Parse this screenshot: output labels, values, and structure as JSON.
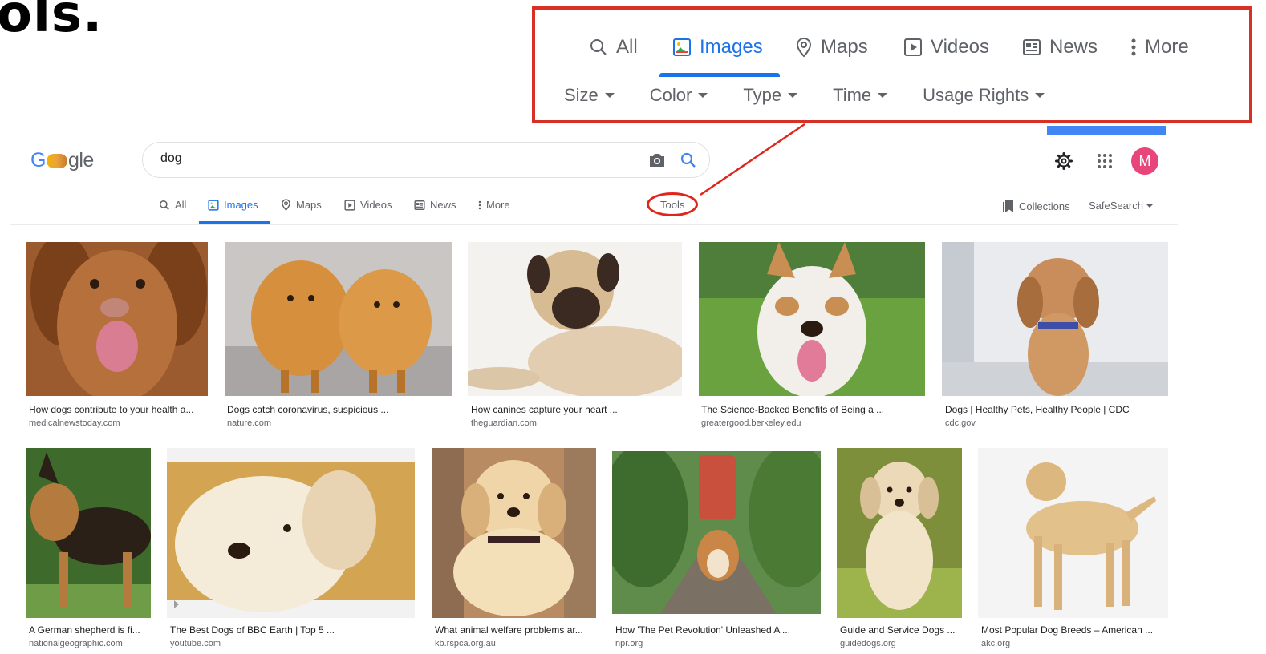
{
  "heading_fragment": "ols.",
  "callout": {
    "tabs": [
      {
        "label": "All",
        "icon": "search-icon",
        "active": false
      },
      {
        "label": "Images",
        "icon": "image-icon",
        "active": true
      },
      {
        "label": "Maps",
        "icon": "map-pin-icon",
        "active": false
      },
      {
        "label": "Videos",
        "icon": "video-icon",
        "active": false
      },
      {
        "label": "News",
        "icon": "news-icon",
        "active": false
      },
      {
        "label": "More",
        "icon": "more-vert-icon",
        "active": false
      }
    ],
    "tools": [
      "Size",
      "Color",
      "Type",
      "Time",
      "Usage Rights"
    ]
  },
  "header": {
    "logo_left": "G",
    "logo_right": "gle",
    "search": {
      "value": "dog"
    }
  },
  "nav": {
    "tabs": [
      {
        "label": "All",
        "icon": "search-icon"
      },
      {
        "label": "Images",
        "icon": "image-icon"
      },
      {
        "label": "Maps",
        "icon": "map-pin-icon"
      },
      {
        "label": "Videos",
        "icon": "video-icon"
      },
      {
        "label": "News",
        "icon": "news-icon"
      },
      {
        "label": "More",
        "icon": "more-vert-icon"
      }
    ],
    "tools_label": "Tools",
    "collections_label": "Collections",
    "safesearch_label": "SafeSearch"
  },
  "avatar": {
    "initial": "M",
    "color": "#e8457a"
  },
  "colors": {
    "accent": "#1a73e8",
    "callout_border": "#d93025"
  },
  "results": [
    {
      "title": "How dogs contribute to your health a...",
      "source": "medicalnewstoday.com"
    },
    {
      "title": "Dogs catch coronavirus, suspicious ...",
      "source": "nature.com"
    },
    {
      "title": "How canines capture your heart ...",
      "source": "theguardian.com"
    },
    {
      "title": "The Science-Backed Benefits of Being a ...",
      "source": "greatergood.berkeley.edu"
    },
    {
      "title": "Dogs | Healthy Pets, Healthy People | CDC",
      "source": "cdc.gov"
    },
    {
      "title": "A German shepherd is fi...",
      "source": "nationalgeographic.com"
    },
    {
      "title": "The Best Dogs of BBC Earth | Top 5 ...",
      "source": "youtube.com"
    },
    {
      "title": "What animal welfare problems ar...",
      "source": "kb.rspca.org.au"
    },
    {
      "title": "How 'The Pet Revolution' Unleashed A ...",
      "source": "npr.org"
    },
    {
      "title": "Guide and Service Dogs ...",
      "source": "guidedogs.org"
    },
    {
      "title": "Most Popular Dog Breeds – American ...",
      "source": "akc.org"
    }
  ]
}
